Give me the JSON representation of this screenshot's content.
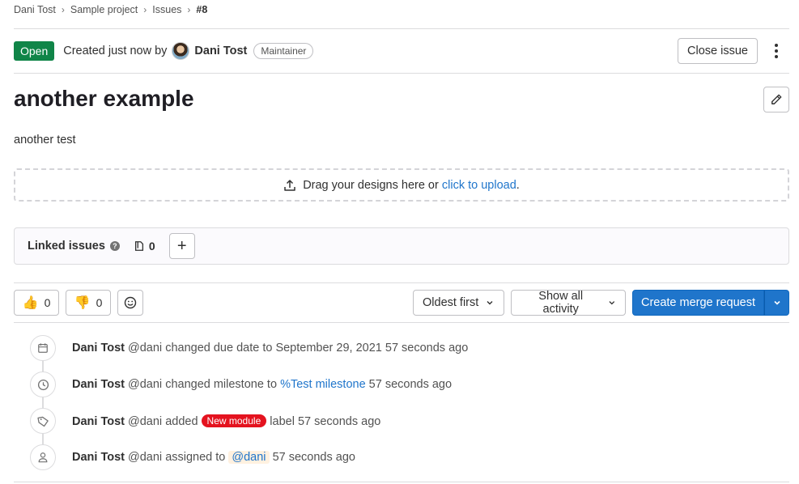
{
  "breadcrumb": {
    "items": [
      "Dani Tost",
      "Sample project",
      "Issues",
      "#8"
    ]
  },
  "header": {
    "status": "Open",
    "created_prefix": "Created just now by",
    "author": "Dani Tost",
    "role": "Maintainer",
    "close_label": "Close issue"
  },
  "issue": {
    "title": "another example",
    "description": "another test"
  },
  "dropzone": {
    "text": "Drag your designs here or ",
    "link": "click to upload",
    "suffix": "."
  },
  "linked": {
    "label": "Linked issues",
    "help": "?",
    "count": "0",
    "add": "+"
  },
  "toolbar": {
    "thumbs_up": {
      "emoji": "👍",
      "count": "0"
    },
    "thumbs_down": {
      "emoji": "👎",
      "count": "0"
    },
    "sort_label": "Oldest first",
    "filter_label": "Show all activity",
    "merge_label": "Create merge request"
  },
  "activity": [
    {
      "icon": "calendar-icon",
      "author": "Dani Tost",
      "handle": "@dani",
      "text": "changed due date to September 29, 2021",
      "time": "57 seconds ago"
    },
    {
      "icon": "clock-icon",
      "author": "Dani Tost",
      "handle": "@dani",
      "text": "changed milestone to",
      "link": "%Test milestone",
      "time": "57 seconds ago"
    },
    {
      "icon": "label-icon",
      "author": "Dani Tost",
      "handle": "@dani",
      "text": "added",
      "label": "New module",
      "text2": "label",
      "time": "57 seconds ago"
    },
    {
      "icon": "user-icon",
      "author": "Dani Tost",
      "handle": "@dani",
      "text": "assigned to",
      "mention": "@dani",
      "time": "57 seconds ago"
    }
  ],
  "colors": {
    "open_badge": "#108548",
    "primary": "#1f75cb",
    "label_new_module": "#e4131f"
  }
}
